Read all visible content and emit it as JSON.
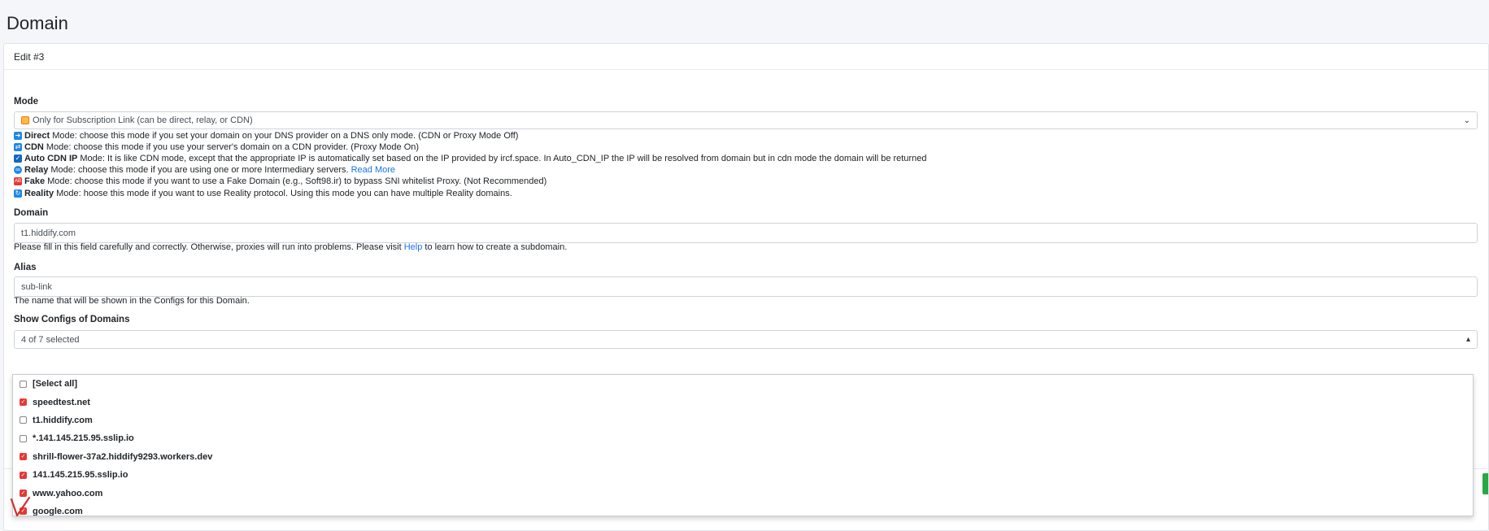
{
  "page": {
    "title": "Domain"
  },
  "card": {
    "header": "Edit #3"
  },
  "mode": {
    "label": "Mode",
    "selected": "Only for Subscription Link (can be direct, relay, or CDN)",
    "descriptions": [
      {
        "icon": "arrow-right-icon",
        "name": "Direct",
        "text": "Mode: choose this mode if you set your domain on your DNS provider on a DNS only mode. (CDN or Proxy Mode Off)"
      },
      {
        "icon": "shuffle-icon",
        "name": "CDN",
        "text": "Mode: choose this mode if you use your server's domain on a CDN provider. (Proxy Mode On)"
      },
      {
        "icon": "check-square-icon",
        "name": "Auto CDN IP",
        "text": "Mode: It is like CDN mode, except that the appropriate IP is automatically set based on the IP provided by ircf.space. In Auto_CDN_IP the IP will be resolved from domain but in cdn mode the domain will be returned"
      },
      {
        "icon": "relay-icon",
        "name": "Relay",
        "text": "Mode: choose this mode if you are using one or more Intermediary servers.",
        "link": "Read More"
      },
      {
        "icon": "fake-icon",
        "name": "Fake",
        "text": "Mode: choose this mode if you want to use a Fake Domain (e.g., Soft98.ir) to bypass SNI whitelist Proxy. (Not Recommended)"
      },
      {
        "icon": "reality-icon",
        "name": "Reality",
        "text": "Mode: hoose this mode if you want to use Reality protocol. Using this mode you can have multiple Reality domains."
      }
    ]
  },
  "domain": {
    "label": "Domain",
    "value": "t1.hiddify.com",
    "help_before": "Please fill in this field carefully and correctly. Otherwise, proxies will run into problems. Please visit",
    "help_link": "Help",
    "help_after": "to learn how to create a subdomain."
  },
  "alias": {
    "label": "Alias",
    "value": "sub-link",
    "help": "The name that will be shown in the Configs for this Domain."
  },
  "show_configs": {
    "label": "Show Configs of Domains",
    "summary": "4 of 7 selected",
    "options": [
      {
        "label": "[Select all]",
        "checked": false
      },
      {
        "label": "speedtest.net",
        "checked": true
      },
      {
        "label": "t1.hiddify.com",
        "checked": false
      },
      {
        "label": "*.141.145.215.95.sslip.io",
        "checked": false
      },
      {
        "label": "shrill-flower-37a2.hiddify9293.workers.dev",
        "checked": true
      },
      {
        "label": "141.145.215.95.sslip.io",
        "checked": true
      },
      {
        "label": "www.yahoo.com",
        "checked": true
      },
      {
        "label": "google.com",
        "checked": true
      }
    ]
  },
  "colors": {
    "accent": "#1a73e8",
    "checkbox": "#e53935",
    "success": "#28a745"
  }
}
